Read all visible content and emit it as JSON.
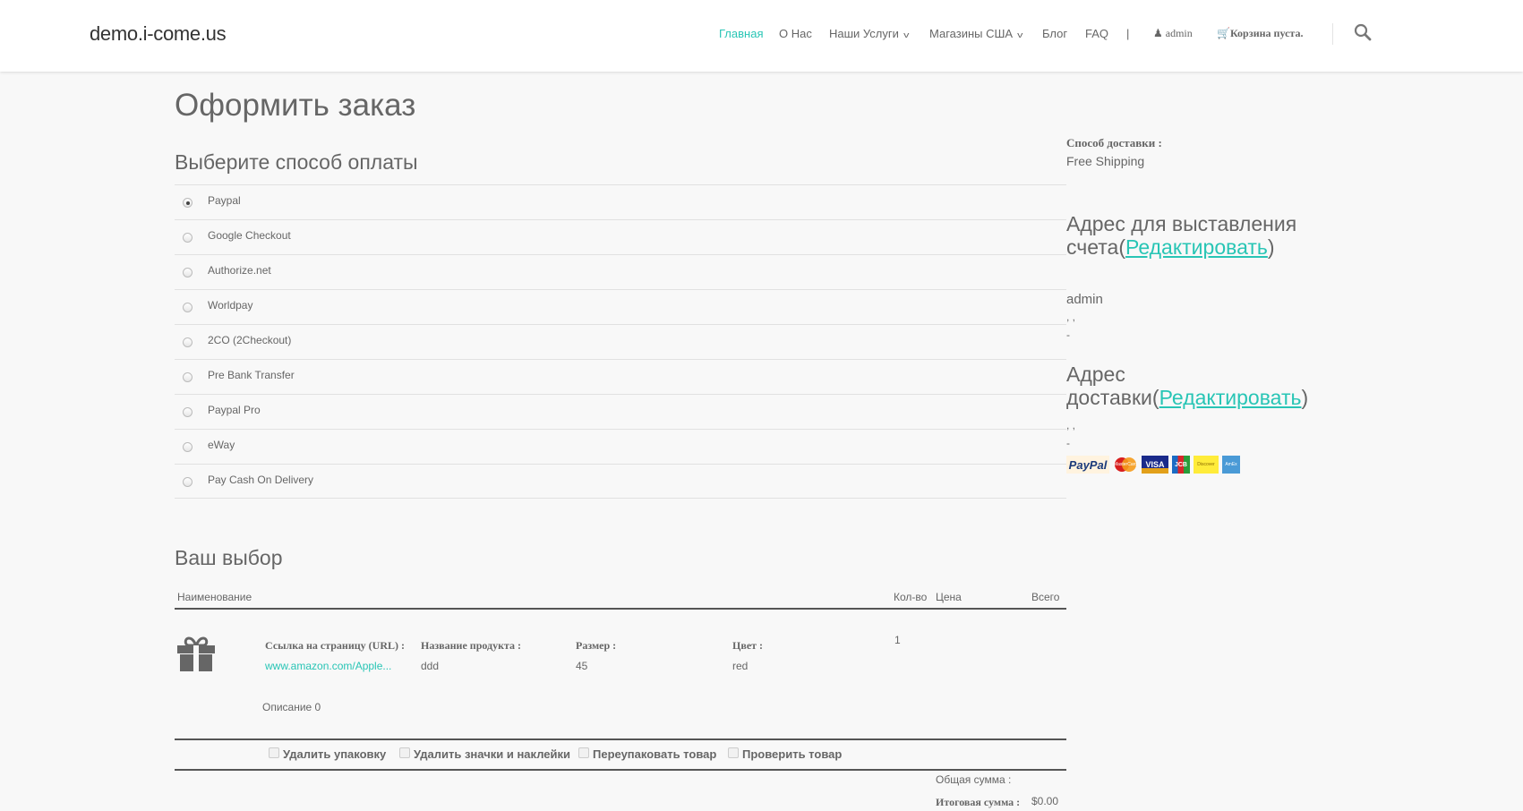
{
  "header": {
    "logo": "demo.i-come.us",
    "nav": [
      {
        "label": "Главная"
      },
      {
        "label": "О Нас"
      },
      {
        "label": "Наши Услуги"
      },
      {
        "label": "Магазины США"
      },
      {
        "label": "Блог"
      },
      {
        "label": "FAQ"
      }
    ],
    "separator": "|",
    "user": "admin",
    "cart": "Корзина пуста."
  },
  "colors": {
    "accent": "#28c5b5",
    "text": "#666666",
    "background": "#f8f8f8"
  },
  "page_title": "Оформить заказ",
  "payment": {
    "title": "Выберите способ оплаты",
    "selected": "Paypal",
    "methods": [
      "Paypal",
      "Google Checkout",
      "Authorize.net",
      "Worldpay",
      "2CO (2Checkout)",
      "Pre Bank Transfer",
      "Paypal Pro",
      "eWay",
      "Pay Cash On Delivery"
    ]
  },
  "cart": {
    "title": "Ваш выбор",
    "columns": {
      "name": "Наименование",
      "qty": "Кол-во",
      "price": "Цена",
      "total": "Всего"
    },
    "item": {
      "url_label": "Ссылка на страницу (URL) :",
      "url": "www.amazon.com/Apple...",
      "name_label": "Название продукта :",
      "name": "ddd",
      "size_label": "Размер :",
      "size": "45",
      "color_label": "Цвет :",
      "color": "red",
      "qty": "1",
      "description": "Описание 0"
    },
    "options": [
      "Удалить упаковку",
      "Удалить значки и наклейки",
      "Переупаковать товар",
      "Проверить товар"
    ],
    "subtotal_label": "Общая сумма :",
    "grand_total_label": "Итоговая сумма :",
    "grand_total": "$0.00"
  },
  "sidebar": {
    "shipping_label": "Способ доставки :",
    "shipping_value": "Free Shipping",
    "billing_title": "Адрес для выставления счета",
    "edit": "Редактировать",
    "billing_name": "admin",
    "billing_line1": ", ,",
    "billing_line2": "-",
    "shipping_title": "Адрес доставки",
    "shipping_line1": ", ,",
    "shipping_line2": "-",
    "cards": [
      "PayPal",
      "MasterCard",
      "VISA",
      "JCB",
      "Discover",
      "AmEx"
    ]
  }
}
